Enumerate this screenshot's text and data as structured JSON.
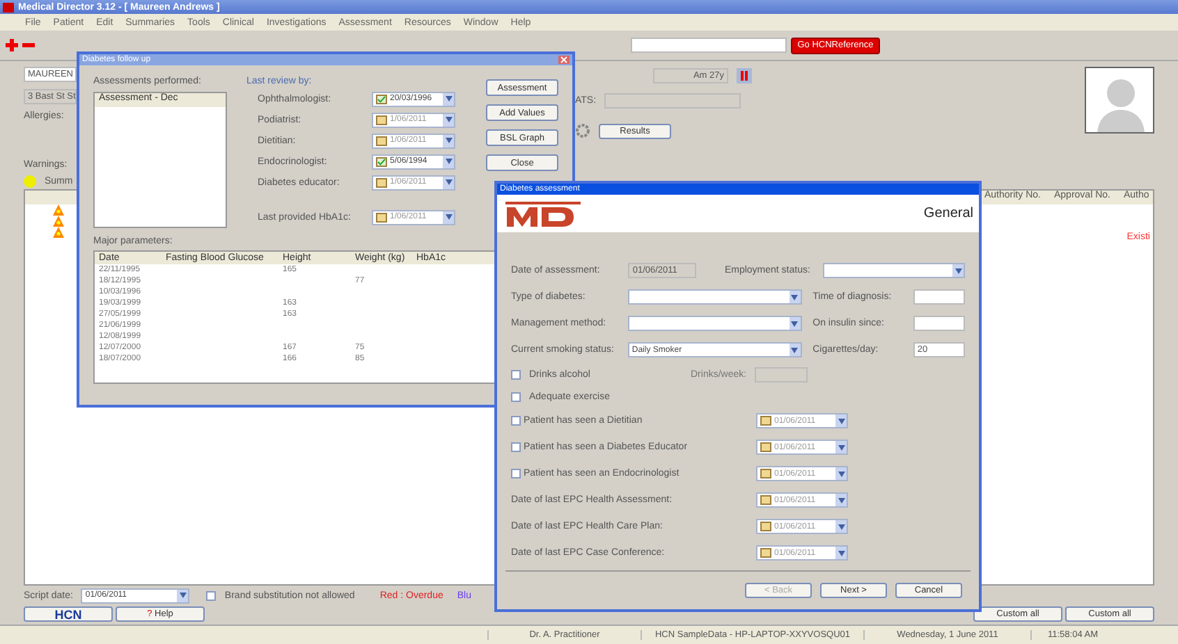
{
  "window": {
    "title": "Medical Director 3.12 - [ Maureen Andrews ]"
  },
  "menu": [
    "File",
    "Patient",
    "Edit",
    "Summaries",
    "Tools",
    "Clinical",
    "Investigations",
    "Assessment",
    "Resources",
    "Window",
    "Help"
  ],
  "toolbar": {
    "hcn_button": "Go HCNReference"
  },
  "patient": {
    "name": "MAUREEN",
    "address": "3 Bast St St",
    "age": "Am 27y",
    "alerts_label": "ATS:",
    "allergies_label": "Allergies:",
    "warnings_label": "Warnings:",
    "results_button": "Results",
    "tab": "Summ"
  },
  "list": {
    "columns": [
      "Authority No.",
      "Approval No.",
      "Autho"
    ],
    "note": "Existi"
  },
  "script_bar": {
    "label": "Script date:",
    "date": "01/06/2011",
    "brand": {
      "label": "Brand substitution not allowed",
      "checked": false
    },
    "legend": [
      {
        "text": "Red : Overdue",
        "color": "#e02020"
      },
      {
        "text": "Blu",
        "color": "#6a3cf0"
      }
    ]
  },
  "bottom_buttons": [
    {
      "label": "HCN",
      "kind": "logo"
    },
    {
      "label": "Help",
      "kind": "help",
      "icon": "?"
    }
  ],
  "right_buttons": [
    "Custom all",
    "Custom all"
  ],
  "status_bar": [
    "Dr. A. Practitioner",
    "HCN SampleData - HP-LAPTOP-XXYVOSQU01",
    "Wednesday, 1 June 2011",
    "11:58:04 AM"
  ],
  "followup_dialog": {
    "title": "Diabetes follow up",
    "assessments_label": "Assessments performed:",
    "assessments": [
      {
        "text": "Assessment - Dec",
        "selected": true
      }
    ],
    "review_label": "Last review by:",
    "reviews": [
      {
        "label": "Ophthalmologist:",
        "date": "20/03/1996",
        "checked": true
      },
      {
        "label": "Podiatrist:",
        "date": "1/06/2011",
        "checked": false
      },
      {
        "label": "Dietitian:",
        "date": "1/06/2011",
        "checked": false
      },
      {
        "label": "Endocrinologist:",
        "date": "5/06/1994",
        "checked": true
      },
      {
        "label": "Diabetes educator:",
        "date": "1/06/2011",
        "checked": false
      }
    ],
    "hba1c": {
      "label": "Last provided HbA1c:",
      "date": "1/06/2011",
      "checked": false
    },
    "buttons": [
      "Assessment",
      "Add Values",
      "BSL Graph",
      "Close"
    ],
    "params_label": "Major parameters:",
    "columns": [
      "Date",
      "Fasting Blood Glucose",
      "Height",
      "Weight (kg)",
      "HbA1c"
    ],
    "rows": [
      [
        "22/11/1995",
        "",
        "165",
        "",
        ""
      ],
      [
        "18/12/1995",
        "",
        "",
        "77",
        ""
      ],
      [
        "10/03/1996",
        "",
        "",
        "",
        ""
      ],
      [
        "19/03/1999",
        "",
        "163",
        "",
        ""
      ],
      [
        "27/05/1999",
        "",
        "163",
        "",
        ""
      ],
      [
        "21/06/1999",
        "",
        "",
        "",
        ""
      ],
      [
        "12/08/1999",
        "",
        "",
        "",
        ""
      ],
      [
        "12/07/2000",
        "",
        "167",
        "75",
        ""
      ],
      [
        "18/07/2000",
        "",
        "166",
        "85",
        ""
      ]
    ]
  },
  "assessment_dialog": {
    "title": "Diabetes assessment",
    "section": "General",
    "date_label": "Date of assessment:",
    "date": "01/06/2011",
    "employment_label": "Employment status:",
    "fields_left": [
      {
        "label": "Type of diabetes:"
      },
      {
        "label": "Management method:"
      },
      {
        "label": "Current smoking status:",
        "value": "Daily Smoker"
      }
    ],
    "fields_right": [
      {
        "label": "Time of diagnosis:"
      },
      {
        "label": "On insulin since:"
      },
      {
        "label": "Cigarettes/day:",
        "value": "20"
      }
    ],
    "drinks": {
      "label": "Drinks alcohol",
      "checked": false,
      "sub_label": "Drinks/week:"
    },
    "exercise": {
      "label": "Adequate exercise",
      "checked": false
    },
    "date_rows": [
      {
        "kind": "check",
        "label": "Patient has seen a Dietitian",
        "checked": false,
        "date": "01/06/2011"
      },
      {
        "kind": "check",
        "label": "Patient has seen a Diabetes Educator",
        "checked": false,
        "date": "01/06/2011"
      },
      {
        "kind": "check",
        "label": "Patient has seen an Endocrinologist",
        "checked": false,
        "date": "01/06/2011"
      },
      {
        "kind": "plain",
        "label": "Date of last EPC Health Assessment:",
        "date": "01/06/2011"
      },
      {
        "kind": "plain",
        "label": "Date of last EPC Health Care Plan:",
        "date": "01/06/2011"
      },
      {
        "kind": "plain",
        "label": "Date of last EPC Case Conference:",
        "date": "01/06/2011"
      }
    ],
    "buttons": [
      {
        "label": "< Back",
        "disabled": true
      },
      {
        "label": "Next >",
        "disabled": false
      },
      {
        "label": "Cancel",
        "disabled": false
      }
    ]
  }
}
